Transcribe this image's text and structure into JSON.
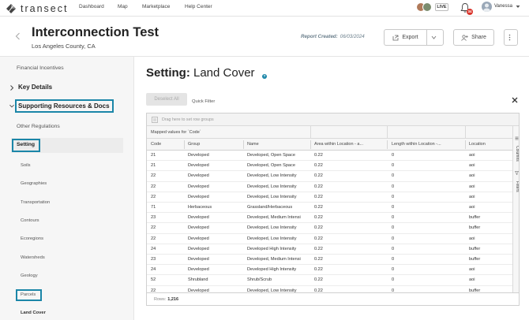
{
  "nav": {
    "brand": "transect",
    "links": [
      "Dashboard",
      "Map",
      "Marketplace",
      "Help Center"
    ],
    "live_label": "LIVE",
    "notification_count": "34",
    "user_name": "Vanessa"
  },
  "header": {
    "title": "Interconnection Test",
    "subtitle": "Los Angeles County, CA",
    "report_created_label": "Report Created:",
    "report_created_date": "06/03/2024",
    "export_label": "Export",
    "share_label": "Share"
  },
  "sidebar": {
    "financial_incentives": "Financial Incentives",
    "key_details": "Key Details",
    "supporting_resources": "Supporting Resources & Docs",
    "other_regulations": "Other Regulations",
    "setting": "Setting",
    "sub_items": [
      "Soils",
      "Geographies",
      "Transportation",
      "Contours",
      "Ecoregions",
      "Watersheds",
      "Geology",
      "Parcels",
      "Land Cover"
    ]
  },
  "main": {
    "title_prefix": "Setting:",
    "title_rest": " Land Cover",
    "deselect_label": "Deselect All",
    "quick_filter_label": "Quick Filter"
  },
  "grid": {
    "drag_hint": "Drag here to set row groups",
    "group_header": "Mapped values for `Code`",
    "columns": [
      "Code",
      "Group",
      "Name",
      "Area within Location - a...",
      "Length within Location -...",
      "Location"
    ],
    "side_tabs": [
      "Columns",
      "Filters"
    ],
    "rows_label": "Rows:",
    "rows_count": "1,216",
    "rows": [
      [
        "21",
        "Developed",
        "Developed, Open Space",
        "0.22",
        "0",
        "aoi"
      ],
      [
        "21",
        "Developed",
        "Developed, Open Space",
        "0.22",
        "0",
        "aoi"
      ],
      [
        "22",
        "Developed",
        "Developed, Low Intensity",
        "0.22",
        "0",
        "aoi"
      ],
      [
        "22",
        "Developed",
        "Developed, Low Intensity",
        "0.22",
        "0",
        "aoi"
      ],
      [
        "22",
        "Developed",
        "Developed, Low Intensity",
        "0.22",
        "0",
        "aoi"
      ],
      [
        "71",
        "Herbaceous",
        "Grassland/Herbaceous",
        "0.22",
        "0",
        "aoi"
      ],
      [
        "23",
        "Developed",
        "Developed, Medium Intensi",
        "0.22",
        "0",
        "buffer"
      ],
      [
        "22",
        "Developed",
        "Developed, Low Intensity",
        "0.22",
        "0",
        "buffer"
      ],
      [
        "22",
        "Developed",
        "Developed, Low Intensity",
        "0.22",
        "0",
        "aoi"
      ],
      [
        "24",
        "Developed",
        "Developed High Intensity",
        "0.22",
        "0",
        "buffer"
      ],
      [
        "23",
        "Developed",
        "Developed, Medium Intensi",
        "0.22",
        "0",
        "buffer"
      ],
      [
        "24",
        "Developed",
        "Developed High Intensity",
        "0.22",
        "0",
        "aoi"
      ],
      [
        "52",
        "Shrubland",
        "Shrub/Scrub",
        "0.22",
        "0",
        "aoi"
      ],
      [
        "22",
        "Developed",
        "Developed, Low Intensity",
        "0.22",
        "0",
        "buffer"
      ]
    ]
  },
  "colors": {
    "accent": "#1b86a8",
    "badge": "#d9342b"
  }
}
